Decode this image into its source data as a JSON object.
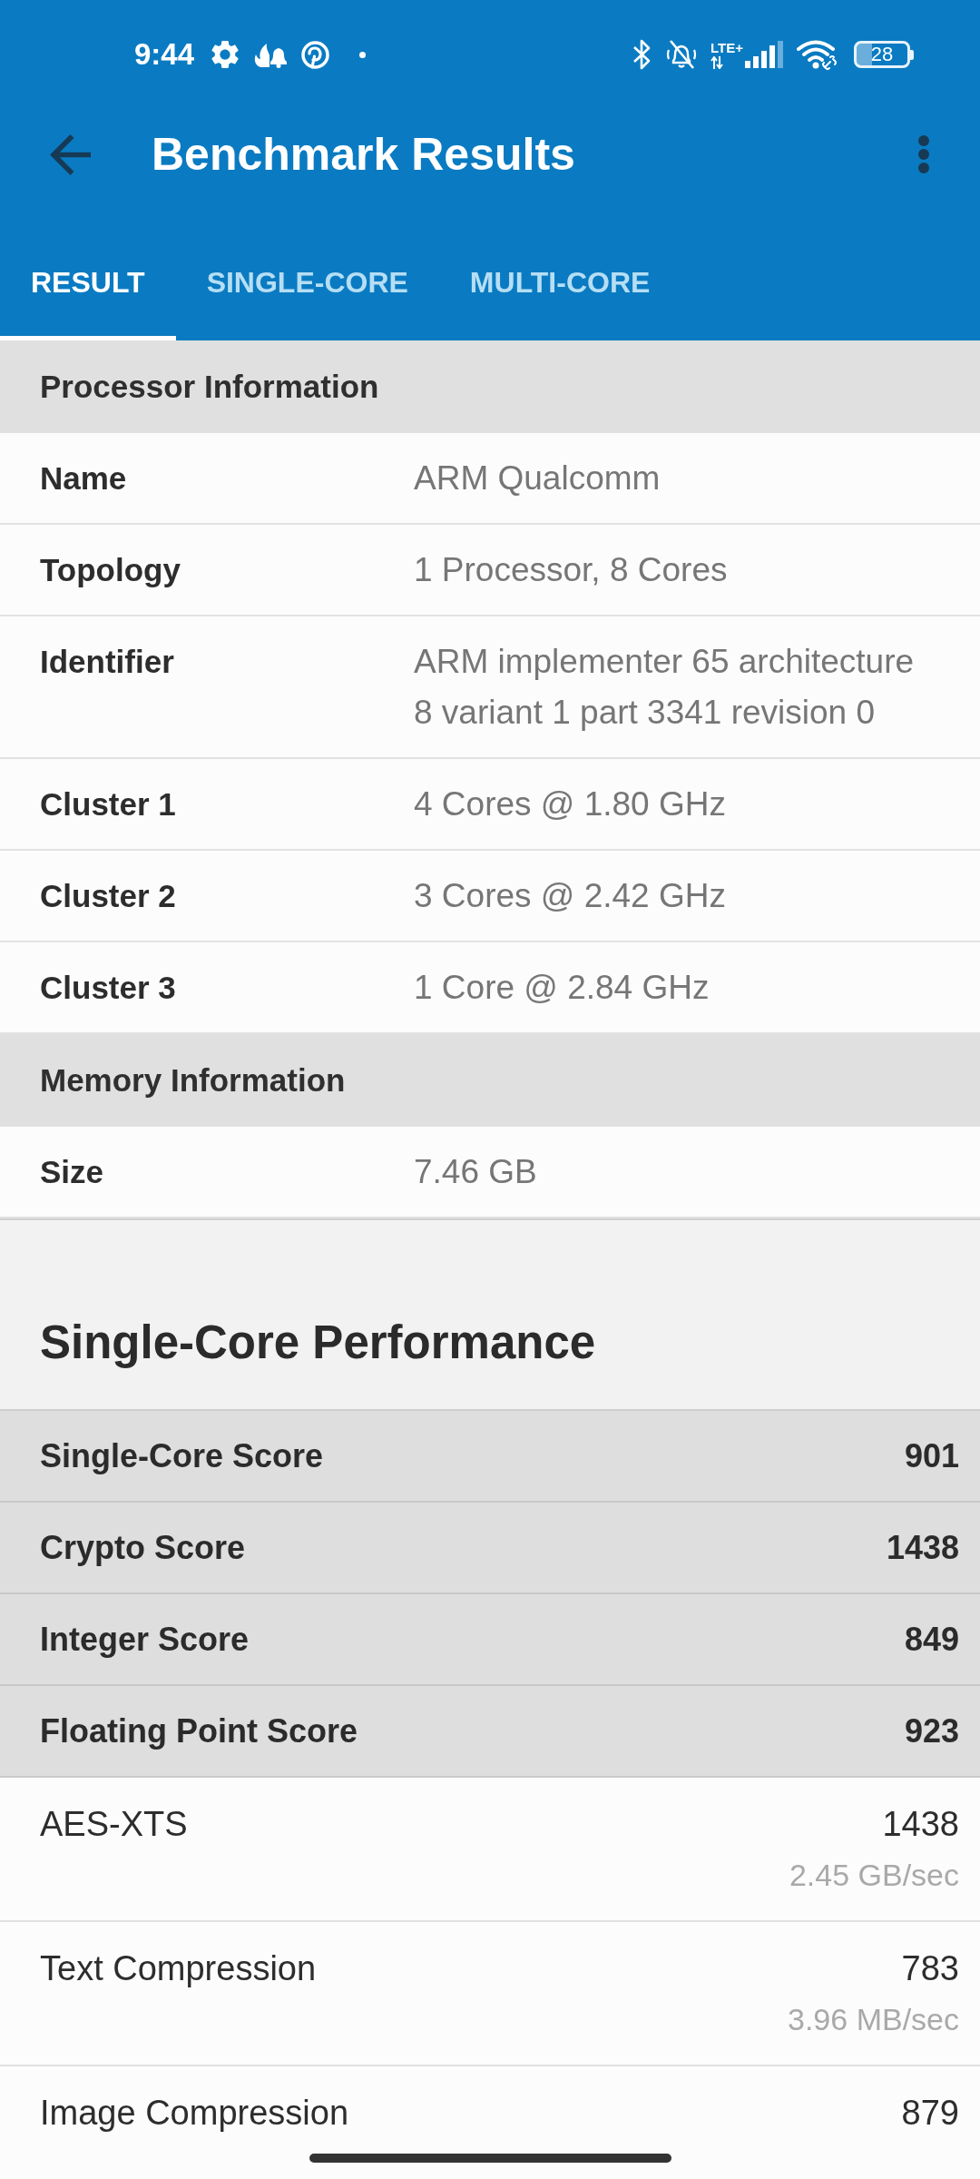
{
  "status_bar": {
    "time": "9:44",
    "network": "LTE+",
    "battery": "28"
  },
  "app_bar": {
    "title": "Benchmark Results"
  },
  "tabs": [
    {
      "label": "RESULT",
      "selected": true
    },
    {
      "label": "SINGLE-CORE",
      "selected": false
    },
    {
      "label": "MULTI-CORE",
      "selected": false
    }
  ],
  "blocks": [
    {
      "kind": "group",
      "title": "Processor Information",
      "rows": [
        {
          "label": "Name",
          "value": "ARM Qualcomm"
        },
        {
          "label": "Topology",
          "value": "1 Processor, 8 Cores"
        },
        {
          "label": "Identifier",
          "value": "ARM implementer 65 architecture 8 variant 1 part 3341 revision 0"
        },
        {
          "label": "Cluster 1",
          "value": "4 Cores @ 1.80 GHz"
        },
        {
          "label": "Cluster 2",
          "value": "3 Cores @ 2.42 GHz"
        },
        {
          "label": "Cluster 3",
          "value": "1 Core @ 2.84 GHz"
        }
      ]
    },
    {
      "kind": "group",
      "title": "Memory Information",
      "rows": [
        {
          "label": "Size",
          "value": "7.46 GB"
        }
      ]
    },
    {
      "kind": "heading",
      "title": "Single-Core Performance"
    },
    {
      "kind": "scores",
      "rows": [
        {
          "label": "Single-Core Score",
          "value": "901"
        },
        {
          "label": "Crypto Score",
          "value": "1438"
        },
        {
          "label": "Integer Score",
          "value": "849"
        },
        {
          "label": "Floating Point Score",
          "value": "923"
        }
      ]
    },
    {
      "kind": "workloads",
      "rows": [
        {
          "label": "AES-XTS",
          "score": "1438",
          "rate": "2.45 GB/sec"
        },
        {
          "label": "Text Compression",
          "score": "783",
          "rate": "3.96 MB/sec"
        },
        {
          "label": "Image Compression",
          "score": "879"
        }
      ]
    }
  ]
}
